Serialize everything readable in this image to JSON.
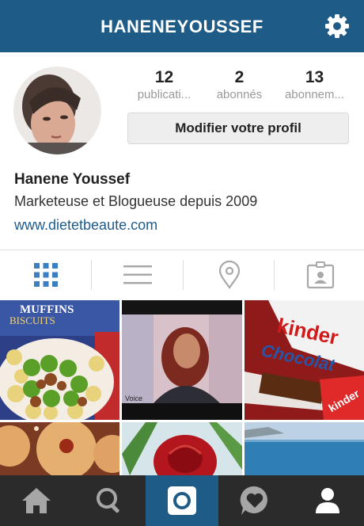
{
  "header": {
    "title": "HANENEYOUSSEF",
    "settings_icon": "gear-icon"
  },
  "profile": {
    "stats": [
      {
        "count": "12",
        "label": "publicati..."
      },
      {
        "count": "2",
        "label": "abonnés"
      },
      {
        "count": "13",
        "label": "abonnem..."
      }
    ],
    "edit_button_label": "Modifier votre profil",
    "full_name": "Hanene Youssef",
    "bio": "Marketeuse et Blogueuse depuis 2009",
    "website": "www.dietetbeaute.com"
  },
  "view_tabs": [
    {
      "icon": "grid-icon",
      "active": true
    },
    {
      "icon": "list-icon",
      "active": false
    },
    {
      "icon": "location-pin-icon",
      "active": false
    },
    {
      "icon": "tagged-photos-icon",
      "active": false
    }
  ],
  "photos": [
    {
      "subject": "muffins-biscuits-fruit-plate",
      "visible_text": "MUFFINS BISCUITS"
    },
    {
      "subject": "woman-on-tv-screen",
      "visible_text": "Voice"
    },
    {
      "subject": "kinder-chocolate-bars",
      "visible_text": "kinder Chocolat"
    },
    {
      "subject": "jam-cookies"
    },
    {
      "subject": "red-rose"
    },
    {
      "subject": "sea-view"
    }
  ],
  "bottom_nav": [
    {
      "icon": "home-icon",
      "active": false
    },
    {
      "icon": "search-icon",
      "active": false
    },
    {
      "icon": "camera-icon",
      "active": true
    },
    {
      "icon": "activity-heart-icon",
      "active": false
    },
    {
      "icon": "profile-icon",
      "active": false
    }
  ],
  "colors": {
    "brand_blue": "#1e5b86",
    "link_blue": "#1f5c8a",
    "nav_dark": "#2b2b2b",
    "active_tab_blue": "#3b7fc0"
  }
}
